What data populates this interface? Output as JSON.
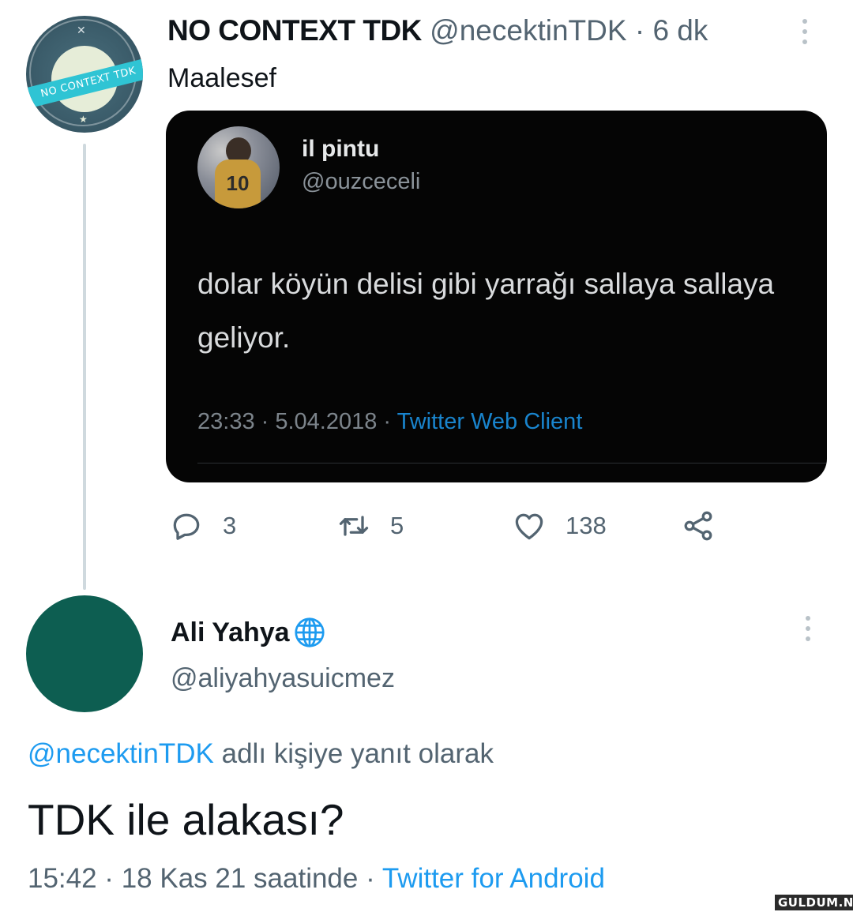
{
  "tweet1": {
    "avatar_text": "NO CONTEXT TDK",
    "display_name": "NO CONTEXT TDK",
    "handle": "@necektinTDK",
    "time": "6 dk",
    "text": "Maalesef",
    "embedded": {
      "avatar_number": "10",
      "display_name": "il pintu",
      "handle": "@ouzceceli",
      "text": "dolar köyün delisi gibi yarrağı sallaya sallaya geliyor.",
      "time": "23:33 · 5.04.2018 · ",
      "client": "Twitter Web Client"
    },
    "actions": {
      "replies": "3",
      "retweets": "5",
      "likes": "138"
    }
  },
  "tweet2": {
    "display_name": "Ali Yahya",
    "handle": "@aliyahyasuicmez",
    "reply_mention": "@necektinTDK",
    "reply_suffix": " adlı kişiye yanıt olarak",
    "text": "TDK ile alakası?",
    "time": "15:42 · 18 Kas 21 saatinde · ",
    "client": "Twitter for Android"
  },
  "watermark": "GULDUM.NET",
  "colors": {
    "accent": "#1d9bf0",
    "secondary_text": "#536471",
    "avatar2": "#0d5e51"
  }
}
